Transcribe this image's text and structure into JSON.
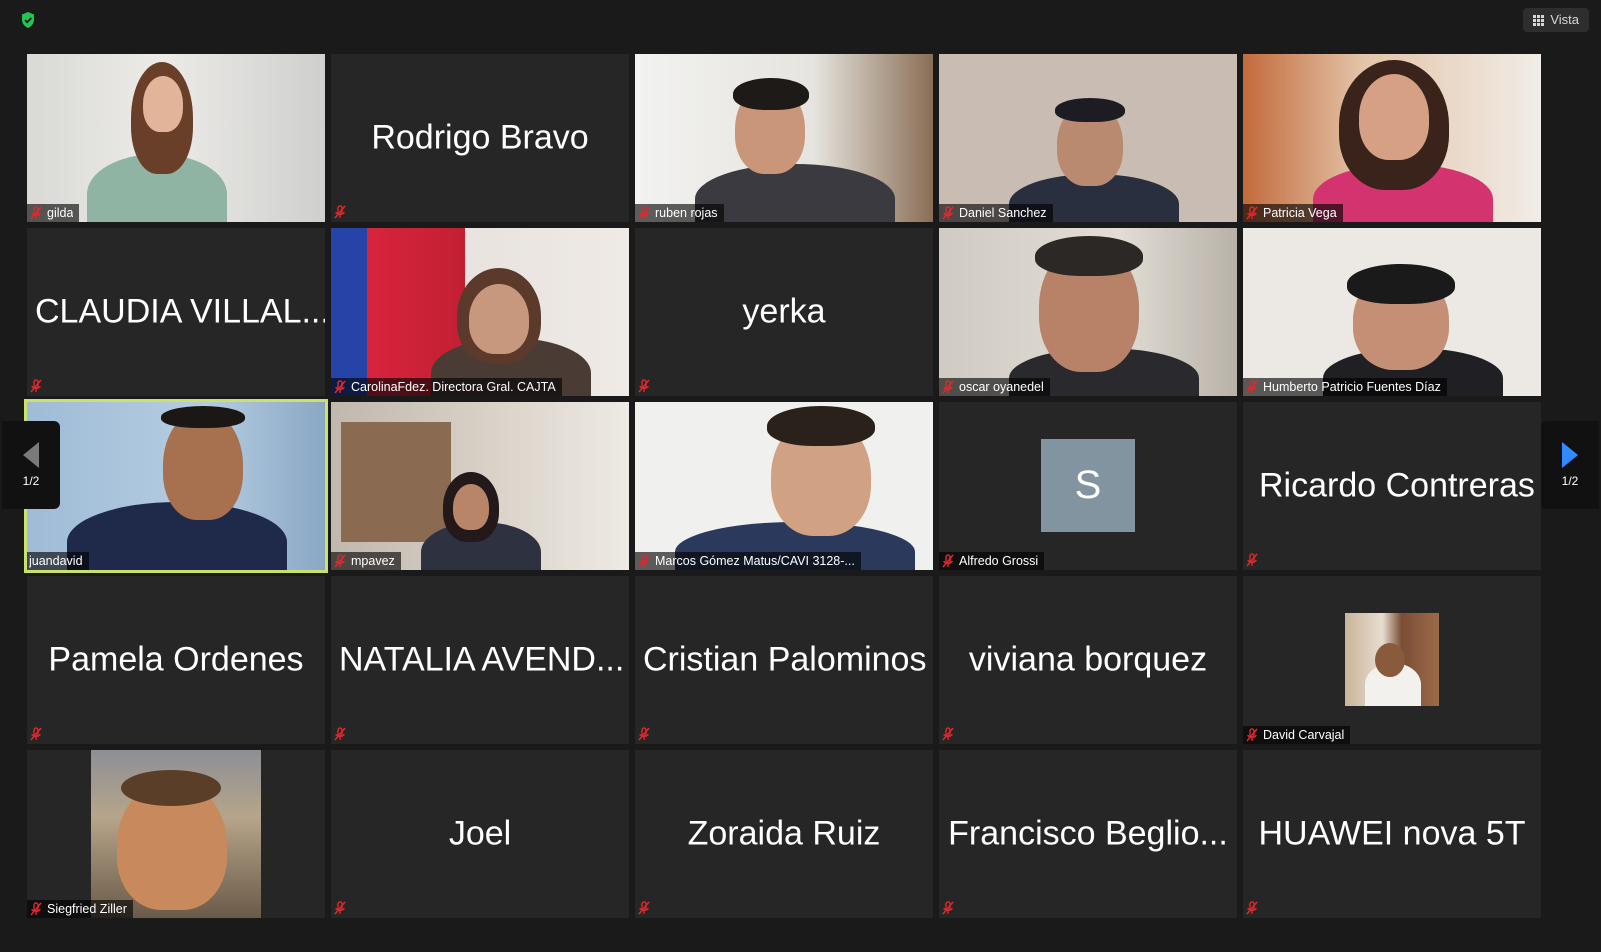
{
  "toolbar": {
    "view_label": "Vista"
  },
  "pagination": {
    "left": "1/2",
    "right": "1/2"
  },
  "tiles": [
    {
      "name": "gilda",
      "mode": "video"
    },
    {
      "name": "Rodrigo Bravo",
      "mode": "name"
    },
    {
      "name": "ruben rojas",
      "mode": "video"
    },
    {
      "name": "Daniel Sanchez",
      "mode": "video"
    },
    {
      "name": "Patricia Vega",
      "mode": "video"
    },
    {
      "name": "CLAUDIA VILLAL...",
      "mode": "name"
    },
    {
      "name": "CarolinaFdez. Directora Gral. CAJTA",
      "mode": "video"
    },
    {
      "name": "yerka",
      "mode": "name"
    },
    {
      "name": "oscar oyanedel",
      "mode": "video"
    },
    {
      "name": "Humberto Patricio Fuentes Díaz",
      "mode": "video"
    },
    {
      "name": "juandavid",
      "mode": "video",
      "active": true
    },
    {
      "name": "mpavez",
      "mode": "video"
    },
    {
      "name": "Marcos Gómez Matus/CAVI 3128-...",
      "mode": "video"
    },
    {
      "name": "Alfredo Grossi",
      "mode": "avatar",
      "initial": "S"
    },
    {
      "name": "Ricardo Contreras",
      "mode": "name"
    },
    {
      "name": "Pamela Ordenes",
      "mode": "name"
    },
    {
      "name": "NATALIA AVEND...",
      "mode": "name"
    },
    {
      "name": "Cristian Palominos",
      "mode": "name"
    },
    {
      "name": "viviana borquez",
      "mode": "name"
    },
    {
      "name": "David Carvajal",
      "mode": "photo-small"
    },
    {
      "name": "Siegfried Ziller",
      "mode": "photo-large"
    },
    {
      "name": "Joel",
      "mode": "name"
    },
    {
      "name": "Zoraida Ruiz",
      "mode": "name"
    },
    {
      "name": "Francisco Beglio...",
      "mode": "name"
    },
    {
      "name": "HUAWEI nova 5T",
      "mode": "name"
    }
  ],
  "colors": {
    "background": "#1a1a1a",
    "tile": "#262626",
    "active_speaker_border": "#c9e36a",
    "muted_mic": "#e0282e",
    "next_arrow": "#2f8bff",
    "shield": "#23c552"
  },
  "icons": {
    "security": "shield-check-icon",
    "view": "grid-icon",
    "muted": "mic-off-icon",
    "prev": "triangle-left-icon",
    "next": "triangle-right-icon"
  }
}
